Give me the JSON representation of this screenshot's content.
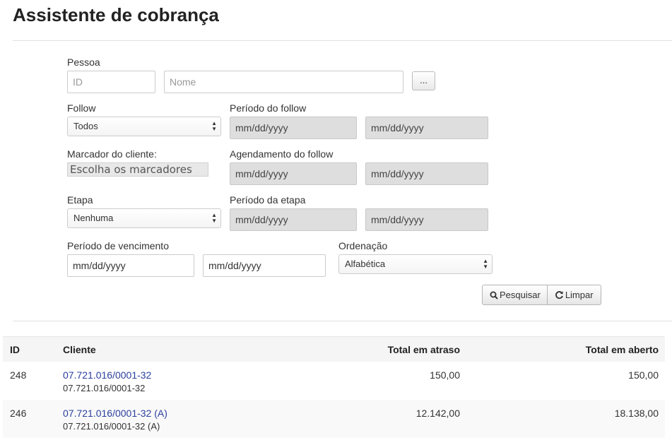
{
  "page": {
    "title": "Assistente de cobrança"
  },
  "form": {
    "pessoa": {
      "label": "Pessoa",
      "id_placeholder": "ID",
      "nome_placeholder": "Nome",
      "lookup_label": "..."
    },
    "follow": {
      "label": "Follow",
      "selected": "Todos"
    },
    "periodo_follow": {
      "label": "Período do follow",
      "from": "mm/dd/yyyy",
      "to": "mm/dd/yyyy"
    },
    "marcador": {
      "label": "Marcador do cliente:",
      "placeholder": "Escolha os marcadores"
    },
    "agendamento_follow": {
      "label": "Agendamento do follow",
      "from": "mm/dd/yyyy",
      "to": "mm/dd/yyyy"
    },
    "etapa": {
      "label": "Etapa",
      "selected": "Nenhuma"
    },
    "periodo_etapa": {
      "label": "Período da etapa",
      "from": "mm/dd/yyyy",
      "to": "mm/dd/yyyy"
    },
    "periodo_vencimento": {
      "label": "Período de vencimento",
      "from": "mm/dd/yyyy",
      "to": "mm/dd/yyyy"
    },
    "ordenacao": {
      "label": "Ordenação",
      "selected": "Alfabética"
    },
    "buttons": {
      "pesquisar": "Pesquisar",
      "limpar": "Limpar"
    }
  },
  "table": {
    "headers": {
      "id": "ID",
      "cliente": "Cliente",
      "total_atraso": "Total em atraso",
      "total_aberto": "Total em aberto"
    },
    "rows": [
      {
        "id": "248",
        "cliente_link": "07.721.016/0001-32",
        "cliente_sub": "07.721.016/0001-32",
        "total_atraso": "150,00",
        "total_aberto": "150,00"
      },
      {
        "id": "246",
        "cliente_link": "07.721.016/0001-32 (A)",
        "cliente_sub": "07.721.016/0001-32 (A)",
        "total_atraso": "12.142,00",
        "total_aberto": "18.138,00"
      }
    ]
  },
  "colors": {
    "link": "#2a3f9e",
    "readonly_bg": "#dedede",
    "header_bg": "#f5f5f5",
    "stripe_bg": "#f9f9f9"
  },
  "icons": {
    "search": "search-icon",
    "refresh": "refresh-icon",
    "select_arrows": "chevron-updown-icon"
  }
}
